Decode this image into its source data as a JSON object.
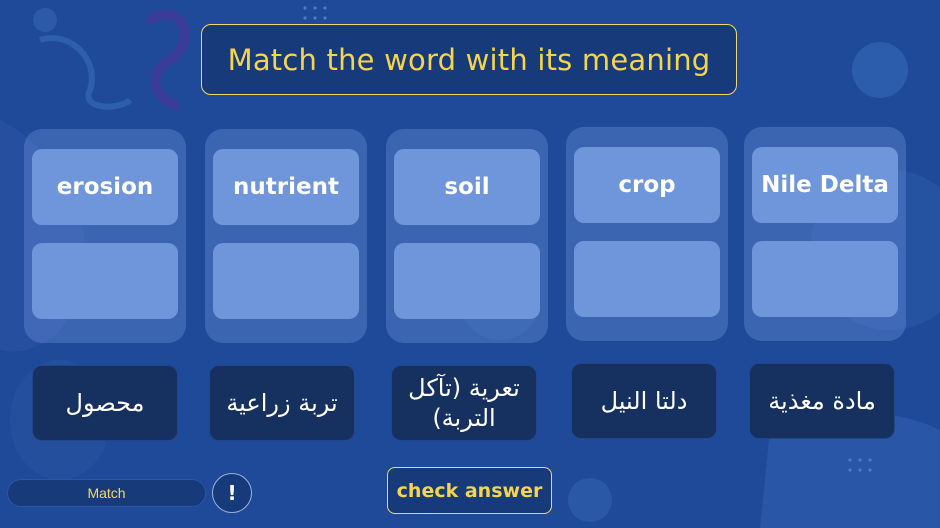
{
  "header": {
    "title": "Match the word with its meaning"
  },
  "words": [
    {
      "label": "erosion"
    },
    {
      "label": "nutrient"
    },
    {
      "label": "soil"
    },
    {
      "label": "crop"
    },
    {
      "label": "Nile Delta"
    }
  ],
  "answers": [
    {
      "label": "محصول"
    },
    {
      "label": "تربة زراعية"
    },
    {
      "label": "تعرية (تآكل التربة)"
    },
    {
      "label": "دلتا النيل"
    },
    {
      "label": "مادة مغذية"
    }
  ],
  "footer": {
    "status_label": "Match",
    "info_label": "!",
    "check_label": "check answer"
  },
  "colors": {
    "background": "#1f4a99",
    "accent": "#f6d44c",
    "card": "#6f95da",
    "tile": "#16305f"
  },
  "icons": {
    "info": "exclamation-icon"
  }
}
